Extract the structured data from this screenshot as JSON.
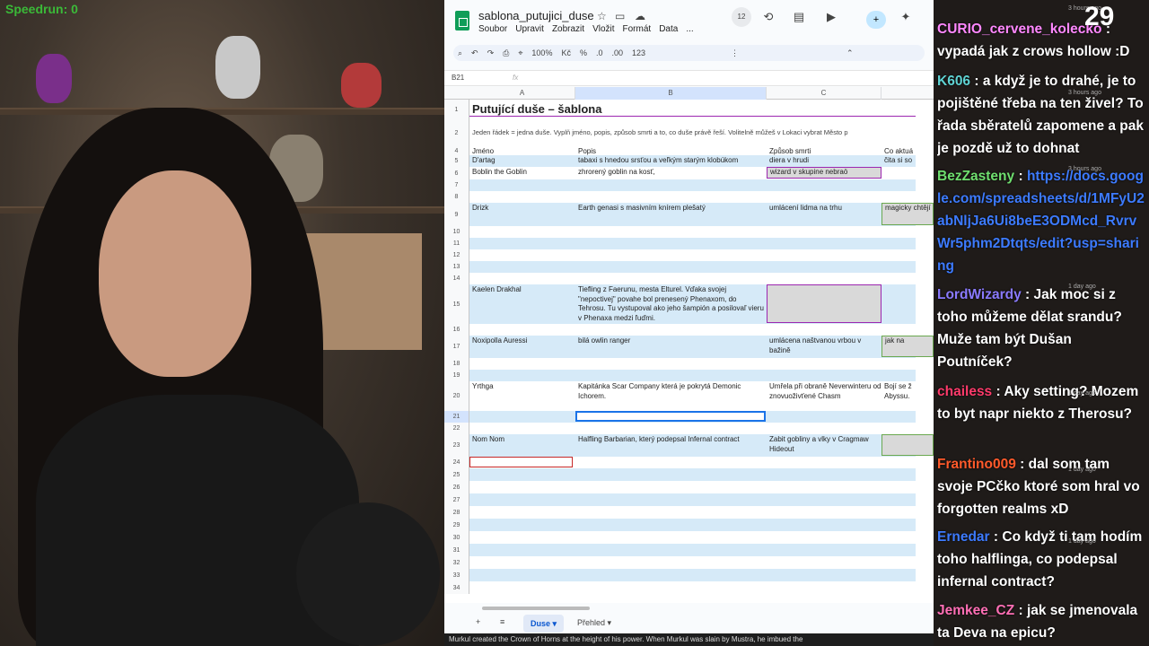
{
  "webcam": {
    "overlay_text": "Speedrun: 0"
  },
  "sheets": {
    "doc_title": "sablona_putujici_duse",
    "menus": [
      "Soubor",
      "Upravit",
      "Zobrazit",
      "Vložit",
      "Formát",
      "Data",
      "..."
    ],
    "toolbar": {
      "zoom": "100%",
      "currency": "Kč",
      "percent": "%",
      "dec_minus": ".0",
      "dec_plus": ".00",
      "format": "123"
    },
    "comment_count": "12",
    "name_box": "B21",
    "fx": "fx",
    "columns": [
      "A",
      "B",
      "C"
    ],
    "rows": [
      {
        "n": "1",
        "a": "Putující duše – šablona",
        "b": "",
        "c": "",
        "d": ""
      },
      {
        "n": "2",
        "a": "Jeden řádek = jedna duše. Vyplň jméno, popis, způsob smrti a to, co duše právě řeší. Volitelně můžeš v Lokaci vybrat Město p",
        "b": "",
        "c": "",
        "d": ""
      },
      {
        "n": "4",
        "a": "Jméno",
        "b": "Popis",
        "c": "Způsob smrti",
        "d": "Co aktuá"
      },
      {
        "n": "5",
        "a": "D'artag",
        "b": "tabaxi s hnedou srsťou a veľkým starým klobúkom",
        "c": "diera v hrudi",
        "d": "čita si so"
      },
      {
        "n": "6",
        "a": "Boblin the Goblin",
        "b": "zhrorený goblin na kosť,",
        "c": "wizard v skupine nebraö",
        "d": ""
      },
      {
        "n": "7",
        "a": "",
        "b": "",
        "c": "",
        "d": ""
      },
      {
        "n": "8",
        "a": "",
        "b": "",
        "c": "",
        "d": ""
      },
      {
        "n": "9",
        "a": "Drizk",
        "b": "Earth genasi s masivním knírem plešatý",
        "c": "umlácení lidma na trhu",
        "d": "magicky chtějí"
      },
      {
        "n": "10",
        "a": "",
        "b": "",
        "c": "",
        "d": ""
      },
      {
        "n": "11",
        "a": "",
        "b": "",
        "c": "",
        "d": ""
      },
      {
        "n": "12",
        "a": "",
        "b": "",
        "c": "",
        "d": ""
      },
      {
        "n": "13",
        "a": "",
        "b": "",
        "c": "",
        "d": ""
      },
      {
        "n": "14",
        "a": "",
        "b": "",
        "c": "",
        "d": ""
      },
      {
        "n": "15",
        "a": "Kaelen Drakhal",
        "b": "Tiefling z Faerunu, mesta Elturel. Vďaka svojej \"nepoctivej\" povahe bol prenesený Phenaxom, do Tehrosu. Tu vystupoval ako jeho šampión a posilovaľ vieru v Phenaxa medzi ľuďmi.",
        "c": "",
        "d": ""
      },
      {
        "n": "16",
        "a": "",
        "b": "",
        "c": "",
        "d": ""
      },
      {
        "n": "17",
        "a": "Noxipolla Auressi",
        "b": "bilá owlin ranger",
        "c": "umlácena naštvanou vrbou v bažině",
        "d": "jak na"
      },
      {
        "n": "18",
        "a": "",
        "b": "",
        "c": "",
        "d": ""
      },
      {
        "n": "19",
        "a": "",
        "b": "",
        "c": "",
        "d": ""
      },
      {
        "n": "20",
        "a": "Yrthga",
        "b": "Kapitánka Scar Company která je pokrytá Demonic Ichorem.",
        "c": "Umřela při obraně Neverwinteru od znovuoživťené Chasm",
        "d": "Bojí se ž Abyssu."
      },
      {
        "n": "21",
        "a": "",
        "b": "",
        "c": "",
        "d": ""
      },
      {
        "n": "22",
        "a": "",
        "b": "",
        "c": "",
        "d": ""
      },
      {
        "n": "23",
        "a": "Nom Nom",
        "b": "Halfling Barbarian, který podepsal Infernal contract",
        "c": "Zabit gobliny a vlky v Cragmaw Hideout",
        "d": ""
      },
      {
        "n": "24",
        "a": "",
        "b": "",
        "c": "",
        "d": ""
      },
      {
        "n": "25",
        "a": "",
        "b": "",
        "c": "",
        "d": ""
      },
      {
        "n": "26",
        "a": "",
        "b": "",
        "c": "",
        "d": ""
      },
      {
        "n": "27",
        "a": "",
        "b": "",
        "c": "",
        "d": ""
      },
      {
        "n": "28",
        "a": "",
        "b": "",
        "c": "",
        "d": ""
      },
      {
        "n": "29",
        "a": "",
        "b": "",
        "c": "",
        "d": ""
      },
      {
        "n": "30",
        "a": "",
        "b": "",
        "c": "",
        "d": ""
      },
      {
        "n": "31",
        "a": "",
        "b": "",
        "c": "",
        "d": ""
      },
      {
        "n": "32",
        "a": "",
        "b": "",
        "c": "",
        "d": ""
      },
      {
        "n": "33",
        "a": "",
        "b": "",
        "c": "",
        "d": ""
      },
      {
        "n": "34",
        "a": "",
        "b": "",
        "c": "",
        "d": ""
      }
    ],
    "tabs": {
      "add": "+",
      "list": "≡",
      "active": "Duse",
      "other": "Přehled"
    },
    "ticker": "Murkul created the Crown of Horns at the height of his power. When Murkul was slain by Mustra, he imbued the"
  },
  "chat": {
    "counter": "29",
    "messages": [
      {
        "user": "CURIO_cervene_kolecko",
        "text": "vypadá jak z crows hollow :D",
        "color": "#ff88ff"
      },
      {
        "user": "K606",
        "text": "a když je to drahé, je to pojištěné třeba na ten živel? To řada sběratelů zapomene a pak je pozdě už to dohnat",
        "color": "#5fd3d3"
      },
      {
        "user": "BezZasteny",
        "text": "https://docs.google.com/spreadsheets/d/1MFyU2abNljJa6Ui8beE3ODMcd_RvrvWr5phm2Dtqts/edit?usp=sharing",
        "color": "#6fdf6f"
      },
      {
        "user": "LordWizardy",
        "text": "Jak moc si z toho můžeme dělat srandu? Muže tam být Dušan Poutníček?",
        "color": "#8a7aff"
      },
      {
        "user": "chailess",
        "text": "Aky setting? Mozem to byt napr niekto z Therosu?",
        "color": "#ff3b6b"
      },
      {
        "user": "Frantino009",
        "text": "dal som tam svoje PCčko ktoré som hral vo forgotten realms xD",
        "color": "#ff5a2b"
      },
      {
        "user": "Ernedar",
        "text": "Co když ti tam hodím toho halflinga, co podepsal infernal contract?",
        "color": "#3d7bff"
      },
      {
        "user": "Jemkee_CZ",
        "text": "jak se jmenovala ta Deva na epicu?",
        "color": "#ff6fb5"
      }
    ],
    "meta": [
      "3 hours ago",
      "3 hours ago",
      "3 hours ago",
      "1 day ago",
      "1 day ago",
      "1 day ago",
      "1 day ago"
    ]
  }
}
